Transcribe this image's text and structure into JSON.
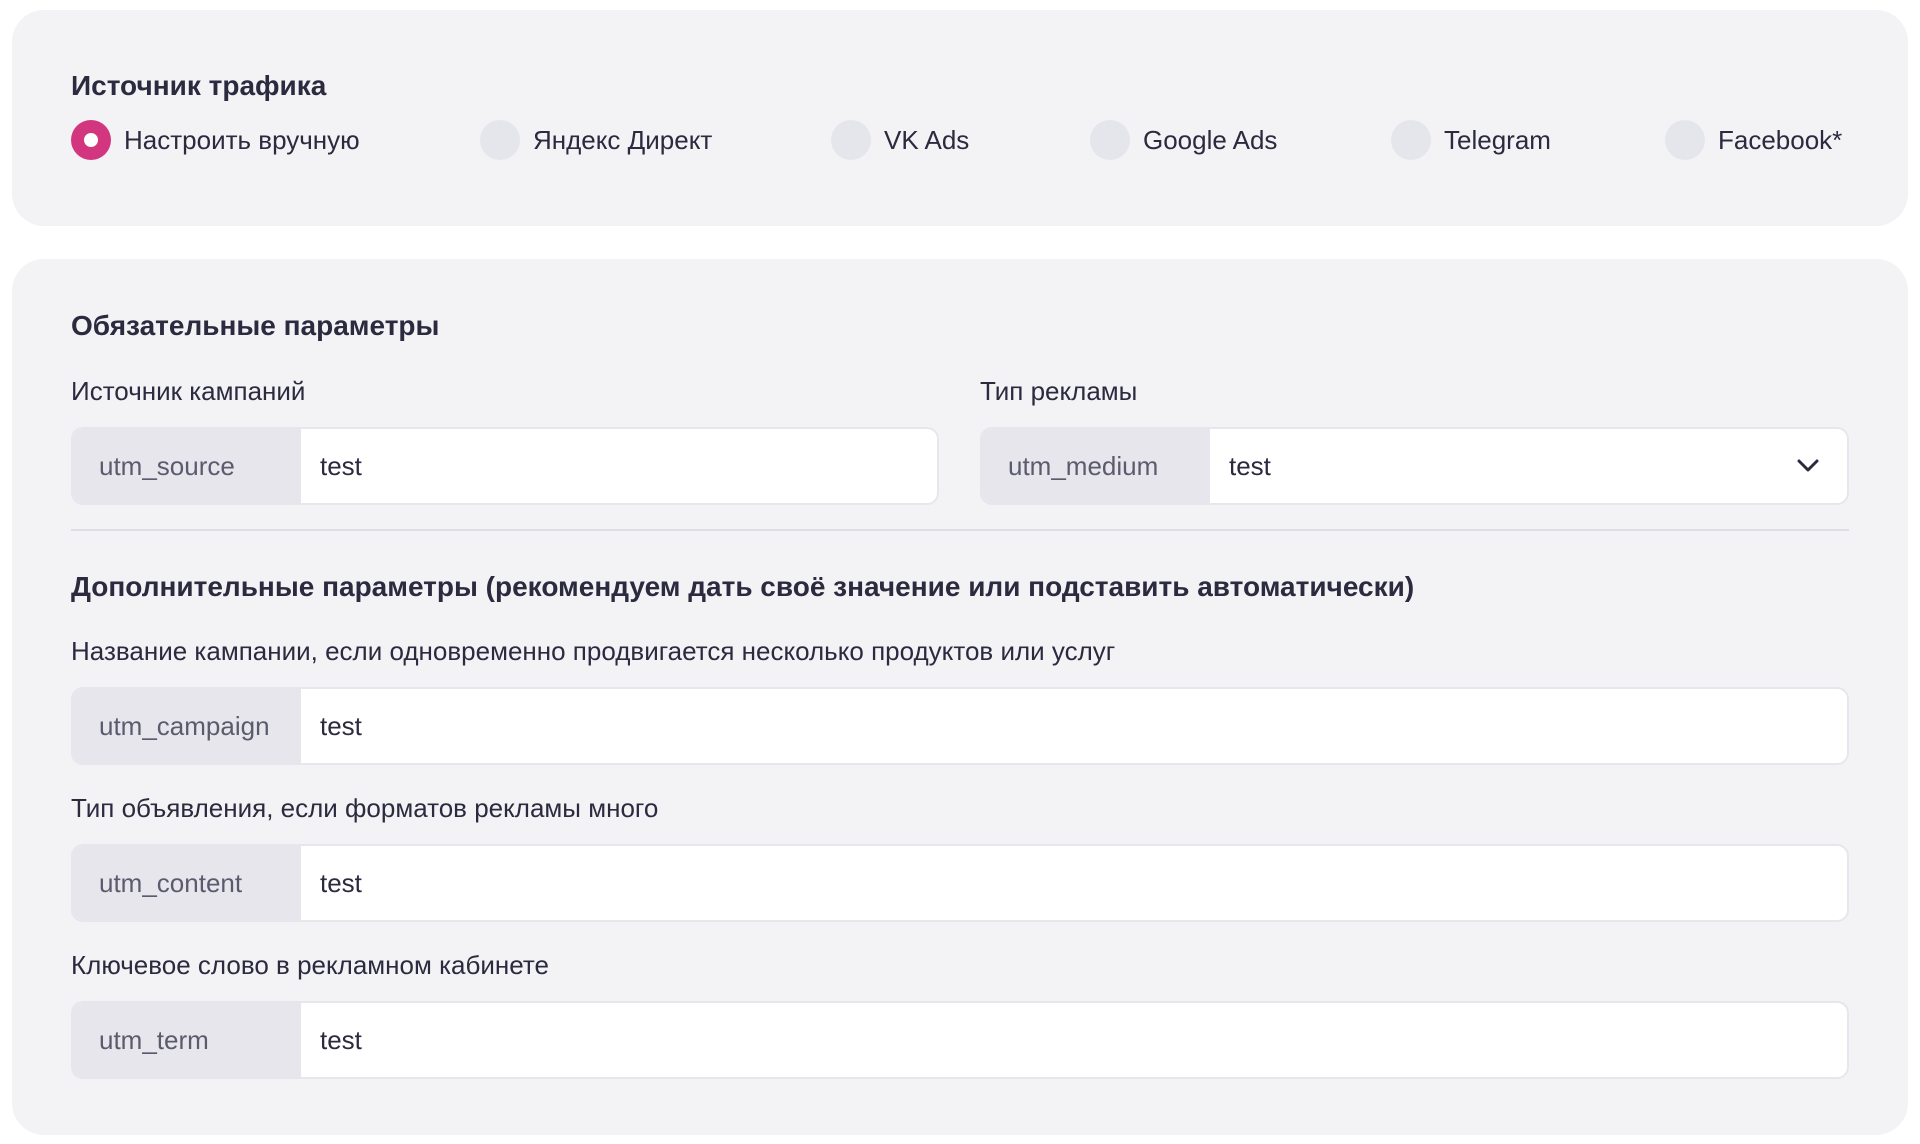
{
  "traffic_source": {
    "title": "Источник трафика",
    "options": [
      {
        "label": "Настроить вручную",
        "checked": true
      },
      {
        "label": "Яндекс Директ",
        "checked": false
      },
      {
        "label": "VK Ads",
        "checked": false
      },
      {
        "label": "Google Ads",
        "checked": false
      },
      {
        "label": "Telegram",
        "checked": false
      },
      {
        "label": "Facebook*",
        "checked": false
      }
    ],
    "accent_color": "#d1367f"
  },
  "required": {
    "title": "Обязательные параметры",
    "source": {
      "label": "Источник кампаний",
      "prefix": "utm_source",
      "value": "test"
    },
    "medium": {
      "label": "Тип рекламы",
      "prefix": "utm_medium",
      "value": "test",
      "icon": "chevron-down-icon"
    }
  },
  "optional": {
    "title": "Дополнительные параметры (рекомендуем дать своё значение или подставить автоматически)",
    "campaign": {
      "label": "Название кампании, если одновременно продвигается несколько продуктов или услуг",
      "prefix": "utm_campaign",
      "value": "test"
    },
    "content": {
      "label": "Тип объявления, если форматов рекламы много",
      "prefix": "utm_content",
      "value": "test"
    },
    "term": {
      "label": "Ключевое слово в рекламном кабинете",
      "prefix": "utm_term",
      "value": "test"
    }
  }
}
